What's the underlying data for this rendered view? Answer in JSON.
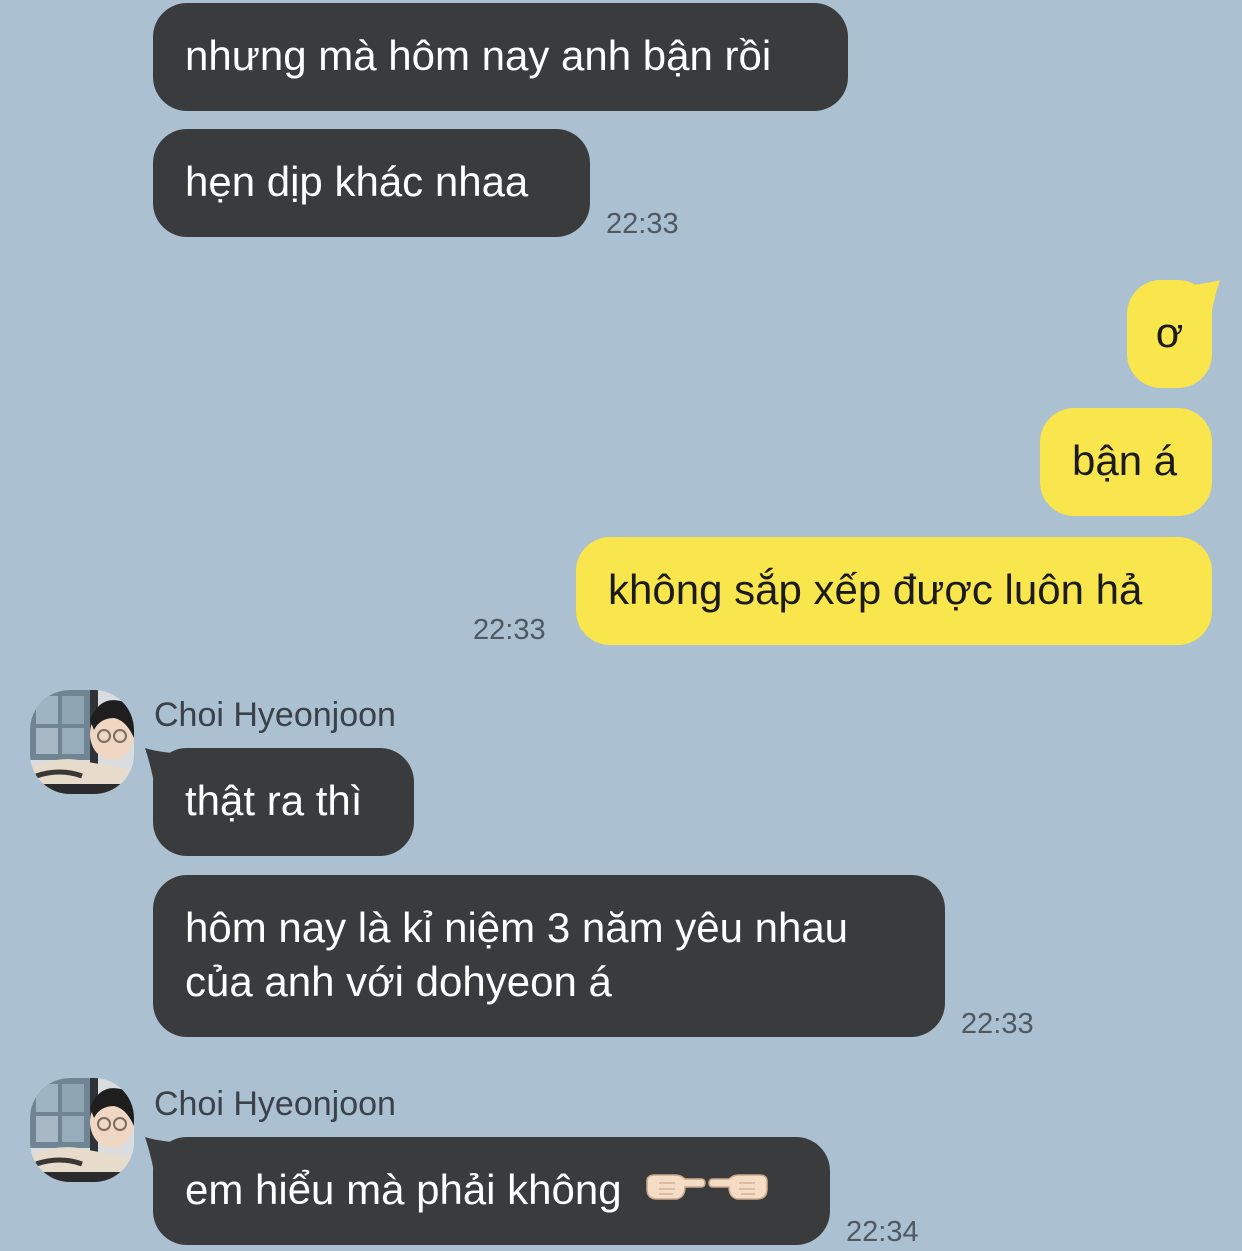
{
  "messages": [
    {
      "direction": "incoming",
      "text": "nhưng mà hôm nay anh bận rồi"
    },
    {
      "direction": "incoming",
      "text": "hẹn dịp khác nhaa",
      "time": "22:33"
    },
    {
      "direction": "outgoing",
      "text": "ơ"
    },
    {
      "direction": "outgoing",
      "text": "bận á"
    },
    {
      "direction": "outgoing",
      "text": "không sắp xếp được luôn hả",
      "time": "22:33"
    },
    {
      "direction": "incoming",
      "sender": "Choi Hyeonjoon",
      "text": "thật ra thì"
    },
    {
      "direction": "incoming",
      "text_line1": "hôm nay là kỉ niệm 3 năm yêu nhau",
      "text_line2": "của anh với dohyeon á",
      "time": "22:33"
    },
    {
      "direction": "incoming",
      "sender": "Choi Hyeonjoon",
      "text": "em hiểu mà phải không",
      "emoji": "👉👈",
      "time": "22:34"
    }
  ],
  "colors": {
    "background": "#abc0d1",
    "incoming_bubble": "#3a3b3d",
    "outgoing_bubble": "#f9e54c"
  },
  "icons": {
    "avatar": "profile-photo-avatar",
    "fingers": "pointing-fingers-emoji"
  }
}
